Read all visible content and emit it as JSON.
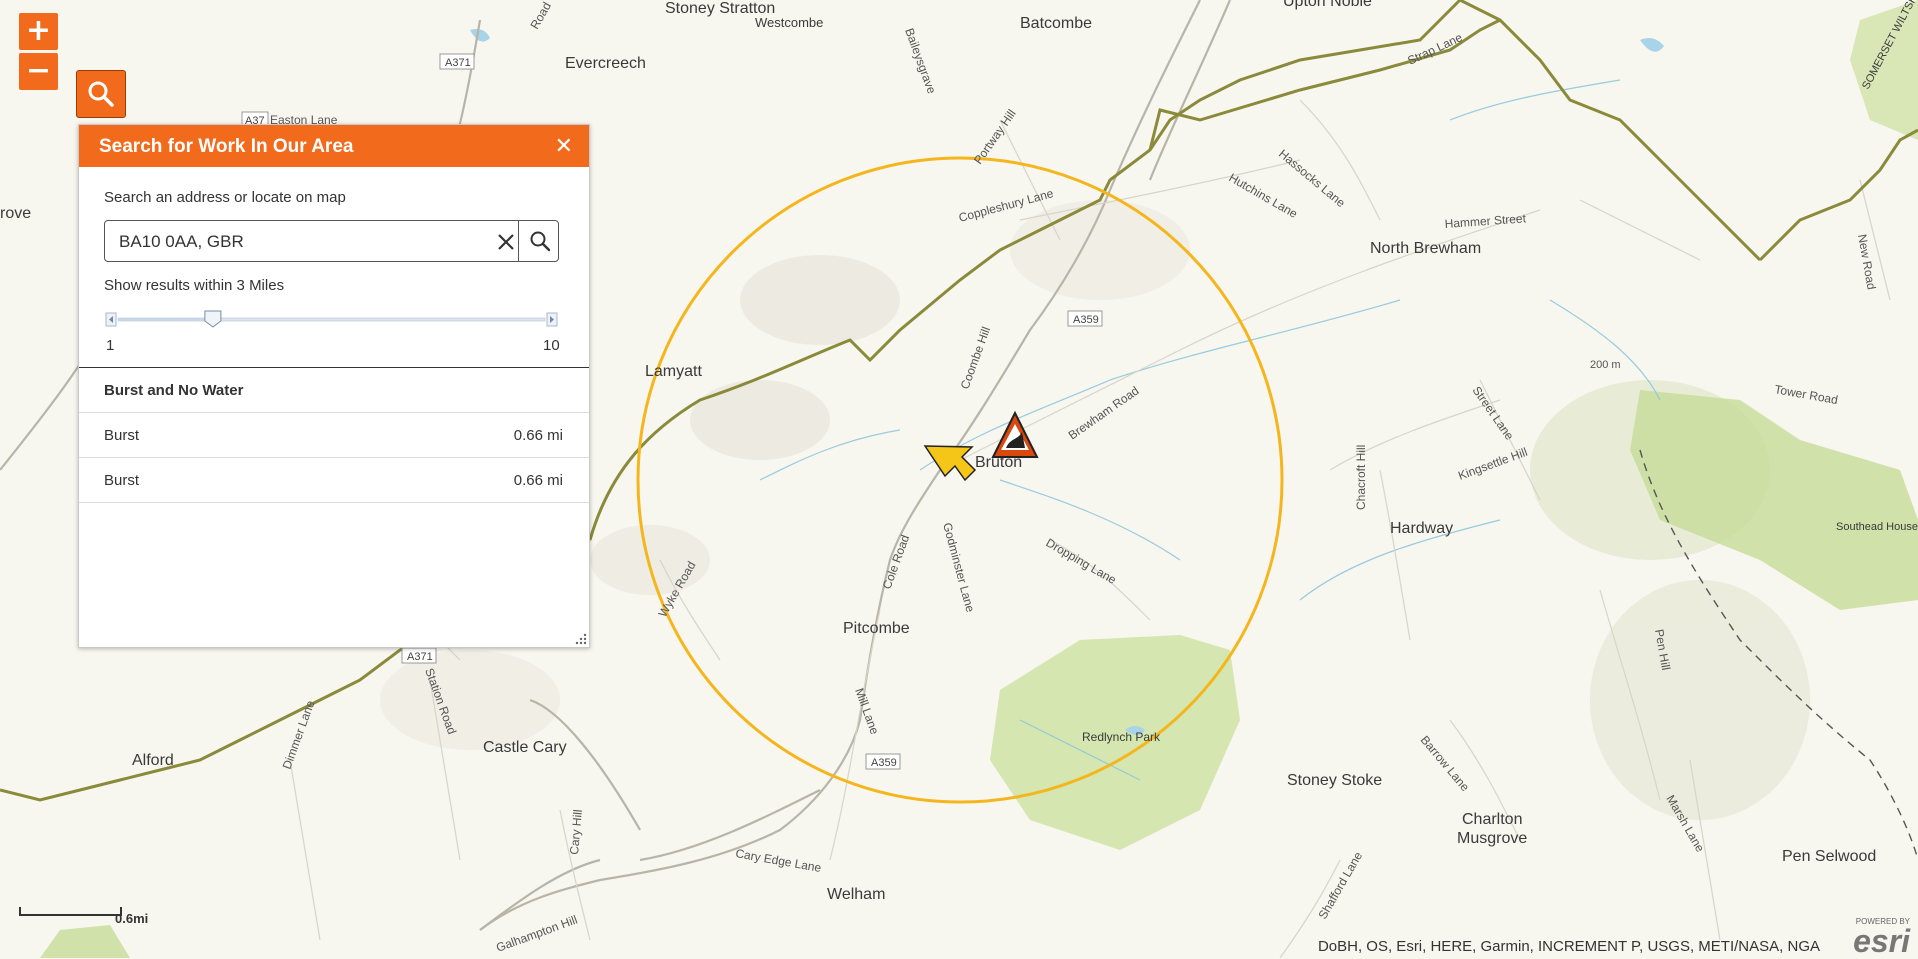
{
  "map": {
    "places": [
      "Stoney Stratton",
      "Westcombe",
      "Batcombe",
      "Upton Noble",
      "Evercreech",
      "rove",
      "Lamyatt",
      "Bruton",
      "North Brewham",
      "Hardway",
      "Pitcombe",
      "Castle Cary",
      "Alford",
      "Redlynch Park",
      "Stoney Stoke",
      "Charlton",
      "Musgrove",
      "Pen Selwood",
      "Welham",
      "Southead House and Gardens",
      "SOMERSET WILTSHIRE"
    ],
    "roads": [
      "Road",
      "A371",
      "Baileysgrave",
      "Portway Hill",
      "Easton Lane",
      "Coppleshury Lane",
      "Hutchins Lane",
      "Hassocks Lane",
      "Strap Lane",
      "Hammer Street",
      "New Road",
      "A359",
      "Coombe Hill",
      "Brewham Road",
      "Tower Road",
      "Street Lane",
      "Chacroft Hill",
      "Kingsettle Hill",
      "Dropping Lane",
      "Godminster Lane",
      "Cole Road",
      "Wyke Road",
      "Mill Lane",
      "Station Road",
      "Dimmer Lane",
      "Cary Hill",
      "Cary Edge Lane",
      "Galhampton Hill",
      "Barrow Lane",
      "Marsh Lane",
      "Pen Hill",
      "Shafford Lane",
      "200 m"
    ],
    "search_radius_miles": 3
  },
  "controls": {
    "zoom_in": "+",
    "zoom_out": "−",
    "search_icon": "search-icon"
  },
  "panel": {
    "title": "Search for Work In Our Area",
    "close": "✕",
    "search_hint": "Search an address or locate on map",
    "search_value": "BA10 0AA, GBR",
    "radius_label": "Show results within 3 Miles",
    "slider": {
      "min": "1",
      "max": "10",
      "value": 3
    },
    "category": "Burst and No Water",
    "results": [
      {
        "name": "Burst",
        "distance": "0.66 mi"
      },
      {
        "name": "Burst",
        "distance": "0.66 mi"
      }
    ]
  },
  "footer": {
    "scale_label": "0.6mi",
    "attribution": "DoBH, OS, Esri, HERE, Garmin, INCREMENT P, USGS, METI/NASA, NGA",
    "esri_powered": "POWERED BY",
    "esri_logo": "esri"
  },
  "colors": {
    "accent": "#f26b1d",
    "radius_circle": "#f5b51c",
    "boundary": "#8a8a3a",
    "park": "#cfe3a6"
  }
}
